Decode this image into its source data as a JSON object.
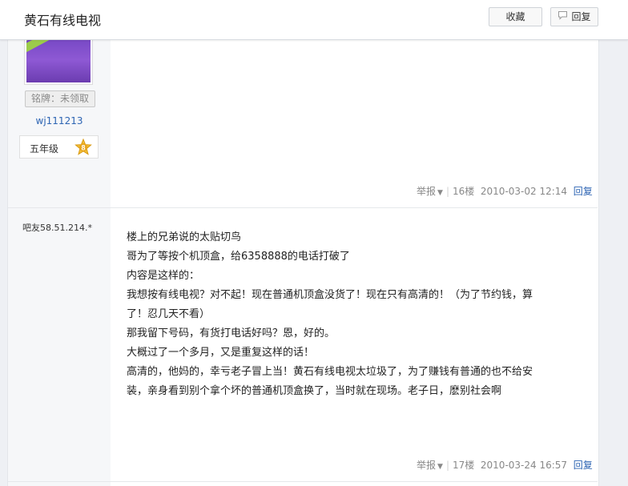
{
  "header": {
    "title": "黄石有线电视",
    "collect_label": "收藏",
    "reply_label": "回复"
  },
  "post1": {
    "medal": "铭牌：未领取",
    "username": "wj111213",
    "level_text": "五年级",
    "level_num": "8",
    "report": "举报",
    "floor": "16楼",
    "time": "2010-03-02 12:14",
    "reply": "回复"
  },
  "post2": {
    "username": "吧友58.51.214.*",
    "lines": [
      "楼上的兄弟说的太贴切鸟",
      "哥为了等按个机顶盒，给6358888的电话打破了",
      "内容是这样的：",
      "我想按有线电视？对不起！现在普通机顶盒没货了！现在只有高清的！（为了节约钱，算",
      "了！忍几天不看）",
      "那我留下号码，有货打电话好吗？恩，好的。",
      "大概过了一个多月，又是重复这样的话！",
      "高清的，他妈的，幸亏老子冒上当！黄石有线电视太垃圾了，为了赚钱有普通的也不给安",
      "装，亲身看到别个拿个坏的普通机顶盒换了，当时就在现场。老子日，麽别社会啊"
    ],
    "report": "举报",
    "floor": "17楼",
    "time": "2010-03-24 16:57",
    "reply": "回复"
  },
  "colors": {
    "link": "#2d64b3",
    "background": "#eef0f4",
    "badge": "#f0b324"
  },
  "icons": {
    "reply": "speech-bubble-icon",
    "level": "star-badge-icon",
    "dropdown": "caret-down-icon"
  }
}
